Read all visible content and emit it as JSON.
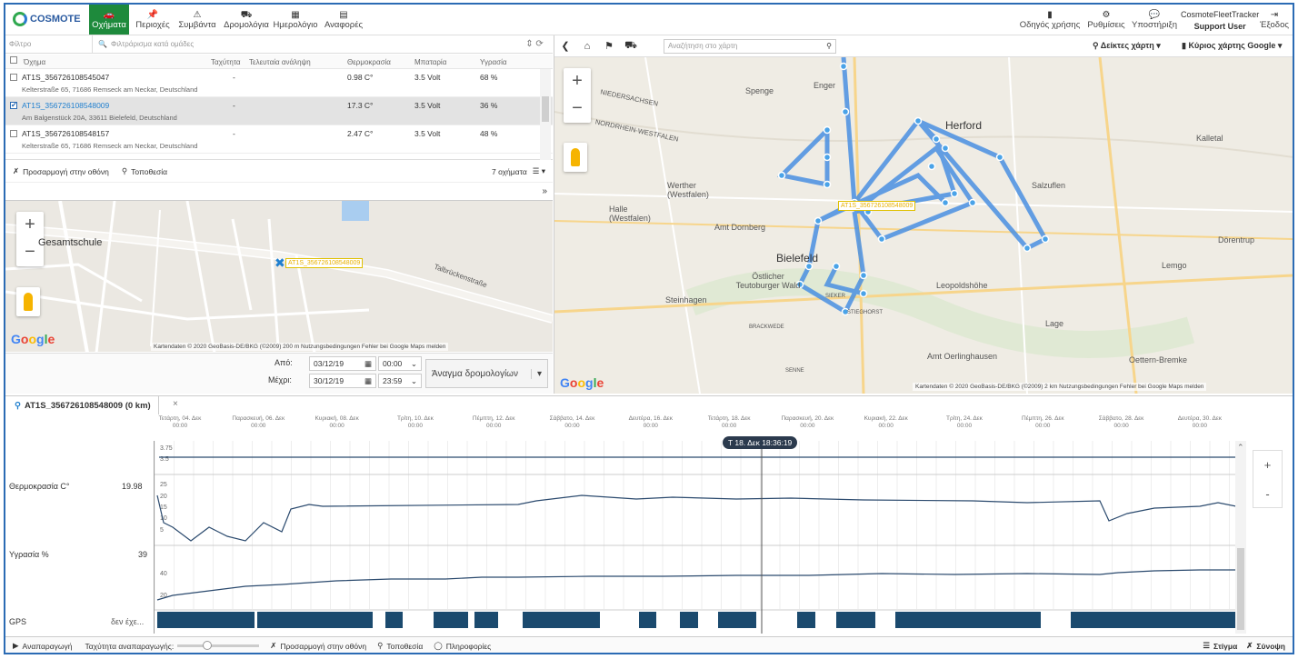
{
  "brand": "COSMOTE",
  "nav": [
    {
      "label": "Οχήματα",
      "icon": "car-icon",
      "active": true
    },
    {
      "label": "Περιοχές",
      "icon": "pin-icon"
    },
    {
      "label": "Συμβάντα",
      "icon": "warning-icon"
    },
    {
      "label": "Δρομολόγια",
      "icon": "route-icon"
    },
    {
      "label": "Ημερολόγιο",
      "icon": "calendar-icon"
    },
    {
      "label": "Αναφορές",
      "icon": "report-icon"
    }
  ],
  "rightnav": [
    {
      "label": "Οδηγός χρήσης",
      "icon": "book-icon"
    },
    {
      "label": "Ρυθμίσεις",
      "icon": "gear-icon"
    },
    {
      "label": "Υποστήριξη",
      "icon": "chat-icon"
    },
    {
      "label": "Έξοδος",
      "icon": "exit-icon"
    }
  ],
  "user": {
    "account": "CosmoteFleetTracker",
    "name": "Support User"
  },
  "filter": {
    "placeholder": "Φίλτρο",
    "group_placeholder": "Φιλτράρισμα κατά ομάδες"
  },
  "table": {
    "headers": [
      "Όχημα",
      "Ταχύτητα",
      "Τελευταία ανάληψη",
      "Θερμοκρασία",
      "Μπαταρία",
      "Υγρασία"
    ],
    "rows": [
      {
        "name": "AT1S_356726108545047",
        "addr": "Kelterstraße 65, 71686 Remseck am Neckar, Deutschland",
        "speed": "-",
        "temp": "0.98 C°",
        "battery": "3.5 Volt",
        "humidity": "68 %"
      },
      {
        "name": "AT1S_356726108548009",
        "addr": "Am Balgenstück 20A, 33611 Bielefeld, Deutschland",
        "speed": "-",
        "temp": "17.3 C°",
        "battery": "3.5 Volt",
        "humidity": "36 %"
      },
      {
        "name": "AT1S_356726108548157",
        "addr": "Kelterstraße 65, 71686 Remseck am Neckar, Deutschland",
        "speed": "-",
        "temp": "2.47 C°",
        "battery": "3.5 Volt",
        "humidity": "48 %"
      }
    ]
  },
  "fit_label": "Προσαρμογή στην οθόνη",
  "location_label": "Τοποθεσία",
  "vehicle_count": "7 οχήματα",
  "smallmap": {
    "label": "AT1S_356726108548009",
    "place": "Gesamtschule",
    "street": "Talbrückenstraße",
    "footer": "Kartendaten © 2020 GeoBasis-DE/BKG (©2009)   200 m      Nutzungsbedingungen   Fehler bei Google Maps melden"
  },
  "dates": {
    "from_label": "Από:",
    "to_label": "Μέχρι:",
    "from_date": "03/12/19",
    "from_time": "00:00",
    "to_date": "30/12/19",
    "to_time": "23:59",
    "route_button": "Άναγμα δρομολογίων"
  },
  "bigmap": {
    "search_placeholder": "Αναζήτηση στο χάρτη",
    "pointer_label": "Δείκτες χάρτη",
    "map_label": "Κύριος χάρτης Google",
    "vehicle_label": "AT1S_356726108548009",
    "footer": "Kartendaten © 2020 GeoBasis-DE/BKG (©2009)   2 km      Nutzungsbedingungen   Fehler bei Google Maps melden",
    "towns": [
      "Spenge",
      "Enger",
      "Herford",
      "Werther (Westfalen)",
      "Halle (Westfalen)",
      "Amt Dornberg",
      "Bielefeld",
      "Östlicher Teutoburger Wald",
      "Steinhagen",
      "Leopoldshöhe",
      "Lage",
      "Lemgo",
      "Kalletal",
      "Dörentrup",
      "Oettern-Bremke",
      "Amt Oerlinghausen",
      "Salzuflen",
      "NIEDERSACHSEN",
      "NORDRHEIN-WESTFALEN",
      "BRACKWEDE",
      "SENNE",
      "STIEGHORST",
      "SIEKER"
    ]
  },
  "tab": {
    "title": "AT1S_356726108548009 (0 km)"
  },
  "time_ticks": [
    "Τετάρτη, 04. Δεκ\n00:00",
    "Παρασκευή, 06. Δεκ\n00:00",
    "Κυριακή, 08. Δεκ\n00:00",
    "Τρίτη, 10. Δεκ\n00:00",
    "Πέμπτη, 12. Δεκ\n00:00",
    "Σάββατο, 14. Δεκ\n00:00",
    "Δευτέρα, 16. Δεκ\n00:00",
    "Τετάρτη, 18. Δεκ\n00:00",
    "Παρασκευή, 20. Δεκ\n00:00",
    "Κυριακή, 22. Δεκ\n00:00",
    "Τρίτη, 24. Δεκ\n00:00",
    "Πέμπτη, 26. Δεκ\n00:00",
    "Σάββατο, 28. Δεκ\n00:00",
    "Δευτέρα, 30. Δεκ\n00:00"
  ],
  "cursor": "Τ 18. Δεκ 18:36:19",
  "rows": {
    "temp_label": "Θερμοκρασία C°",
    "temp_value": "19.98",
    "hum_label": "Υγρασία %",
    "hum_value": "39",
    "gps_label": "GPS",
    "gps_value": "δεν έχε..."
  },
  "axis_labels": {
    "battery_top": "3.75",
    "battery_bot": "3.5",
    "temp_25": "25",
    "temp_20": "20",
    "temp_15": "15",
    "temp_10": "10",
    "temp_5": "5",
    "hum_40": "40",
    "hum_20": "20"
  },
  "bottom": {
    "play": "Αναπαραγωγή",
    "speed": "Ταχύτητα αναπαραγωγής:",
    "fit": "Προσαρμογή στην οθόνη",
    "location": "Τοποθεσία",
    "info": "Πληροφορίες",
    "snapshot": "Στίγμα",
    "zoom": "Σύνοψη"
  },
  "colors": {
    "accent": "#1e8a3c",
    "route": "#4a90e2",
    "pin": "#1f7fcf",
    "gps": "#1b4a6e"
  }
}
